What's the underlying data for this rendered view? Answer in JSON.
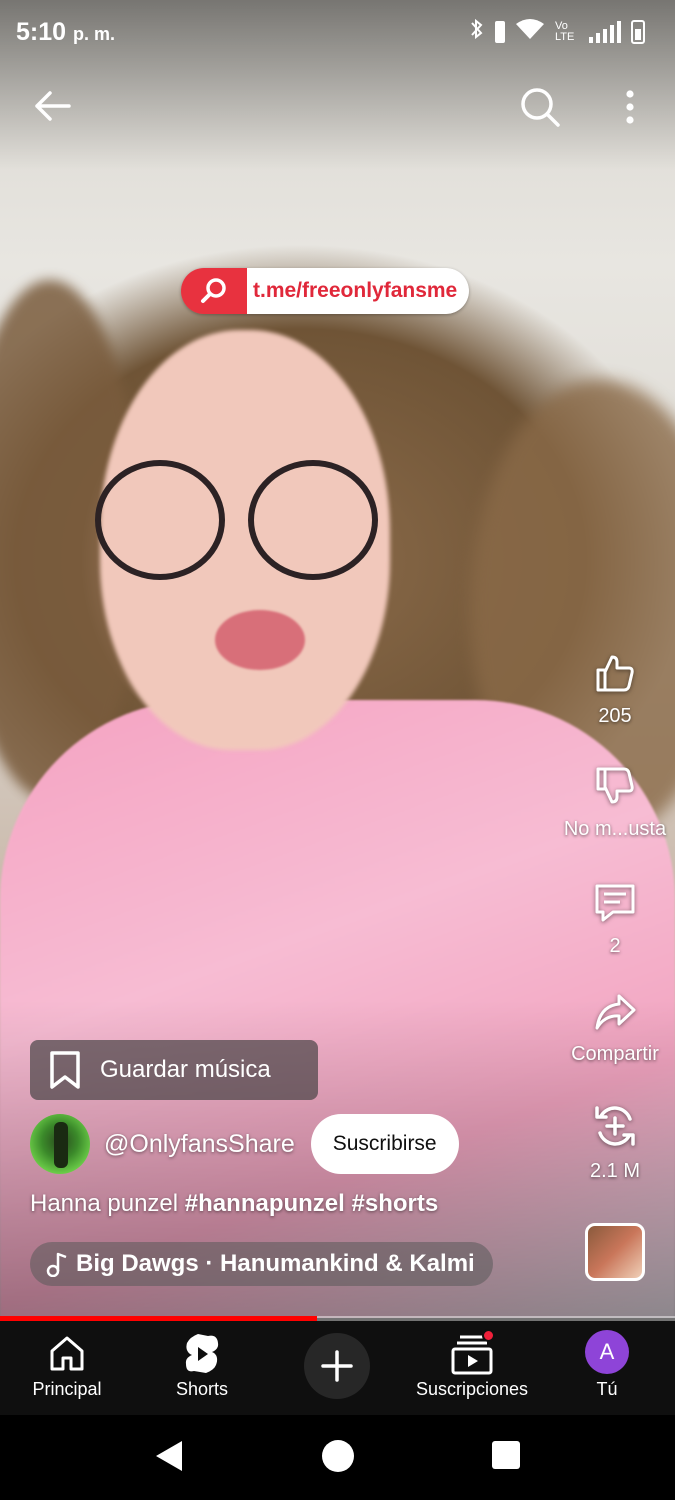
{
  "status_bar": {
    "time": "5:10",
    "time_suffix": "p. m.",
    "network_label": "Vo LTE"
  },
  "overlay_link": {
    "text": "t.me/freeonlyfansme"
  },
  "actions": {
    "like_count": "205",
    "dislike_label": "No m...usta",
    "comment_count": "2",
    "share_label": "Compartir",
    "remix_count": "2.1 M"
  },
  "save_music": {
    "label": "Guardar música"
  },
  "channel": {
    "handle": "@OnlyfansShare",
    "subscribe_label": "Suscribirse"
  },
  "caption": {
    "text": "Hanna punzel",
    "hashtags": [
      "#hannapunzel",
      "#shorts"
    ]
  },
  "music": {
    "track": "Big Dawgs · Hanumankind & Kalmi"
  },
  "playback": {
    "progress": 0.47
  },
  "bottom_nav": {
    "items": [
      {
        "label": "Principal",
        "icon": "home-icon"
      },
      {
        "label": "Shorts",
        "icon": "shorts-icon"
      },
      {
        "label": "",
        "icon": "create-icon"
      },
      {
        "label": "Suscripciones",
        "icon": "subscriptions-icon"
      },
      {
        "label": "Tú",
        "icon": "avatar"
      }
    ],
    "you_initial": "A"
  },
  "colors": {
    "accent_red": "#ff0000",
    "link_red": "#e8323f",
    "nav_background": "#0f0f0f",
    "avatar_purple": "#8e44d8"
  }
}
